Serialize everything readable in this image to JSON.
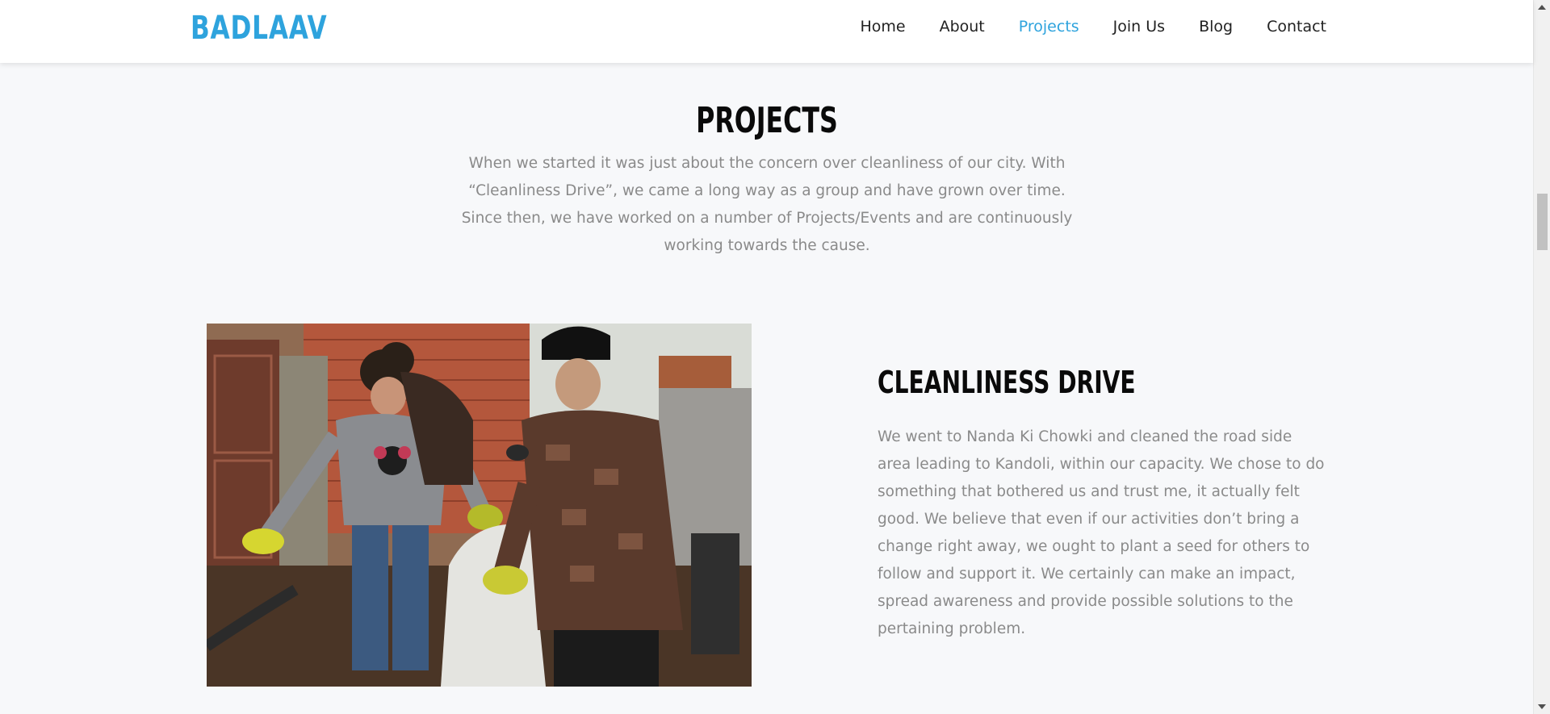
{
  "header": {
    "brand": "BADLAAV",
    "nav": [
      {
        "label": "Home",
        "active": false
      },
      {
        "label": "About",
        "active": false
      },
      {
        "label": "Projects",
        "active": true
      },
      {
        "label": "Join Us",
        "active": false
      },
      {
        "label": "Blog",
        "active": false
      },
      {
        "label": "Contact",
        "active": false
      }
    ]
  },
  "section": {
    "title": "PROJECTS",
    "intro": "When we started it was just about the concern over cleanliness of our city. With “Cleanliness Drive”, we came a long way as a group and have grown over time. Since then, we have worked on a number of Projects/Events and are continuously working towards the cause."
  },
  "project": {
    "title": "CLEANLINESS DRIVE",
    "description": "We went to Nanda Ki Chowki and cleaned the road side area leading to Kandoli, within our capacity. We chose to do something that bothered us and trust me, it actually felt good. We believe that even if our activities don’t bring a change right away, we ought to plant a seed for others to follow and support it. We certainly can make an impact, spread awareness and provide possible solutions to the pertaining problem."
  },
  "colors": {
    "accent": "#2ea3dd",
    "heading": "#0a0a0a",
    "body_text": "#8a8a8a",
    "background": "#f7f8fa"
  }
}
